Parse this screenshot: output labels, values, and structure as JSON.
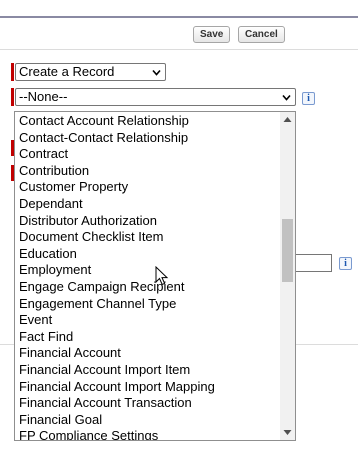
{
  "toolbar": {
    "save_label": "Save",
    "cancel_label": "Cancel"
  },
  "action_select": {
    "value": "Create a Record"
  },
  "object_select": {
    "value": "--None--",
    "options": [
      "Contact Account Relationship",
      "Contact-Contact Relationship",
      "Contract",
      "Contribution",
      "Customer Property",
      "Dependant",
      "Distributor Authorization",
      "Document Checklist Item",
      "Education",
      "Employment",
      "Engage Campaign Recipient",
      "Engagement Channel Type",
      "Event",
      "Fact Find",
      "Financial Account",
      "Financial Account Import Item",
      "Financial Account Import Mapping",
      "Financial Account Transaction",
      "Financial Goal",
      "FP Compliance Settings"
    ]
  },
  "info_icon": "i",
  "colors": {
    "required_bar": "#c00000",
    "topbar_border": "#8a8aa3",
    "info_icon": "#1a56b0"
  }
}
